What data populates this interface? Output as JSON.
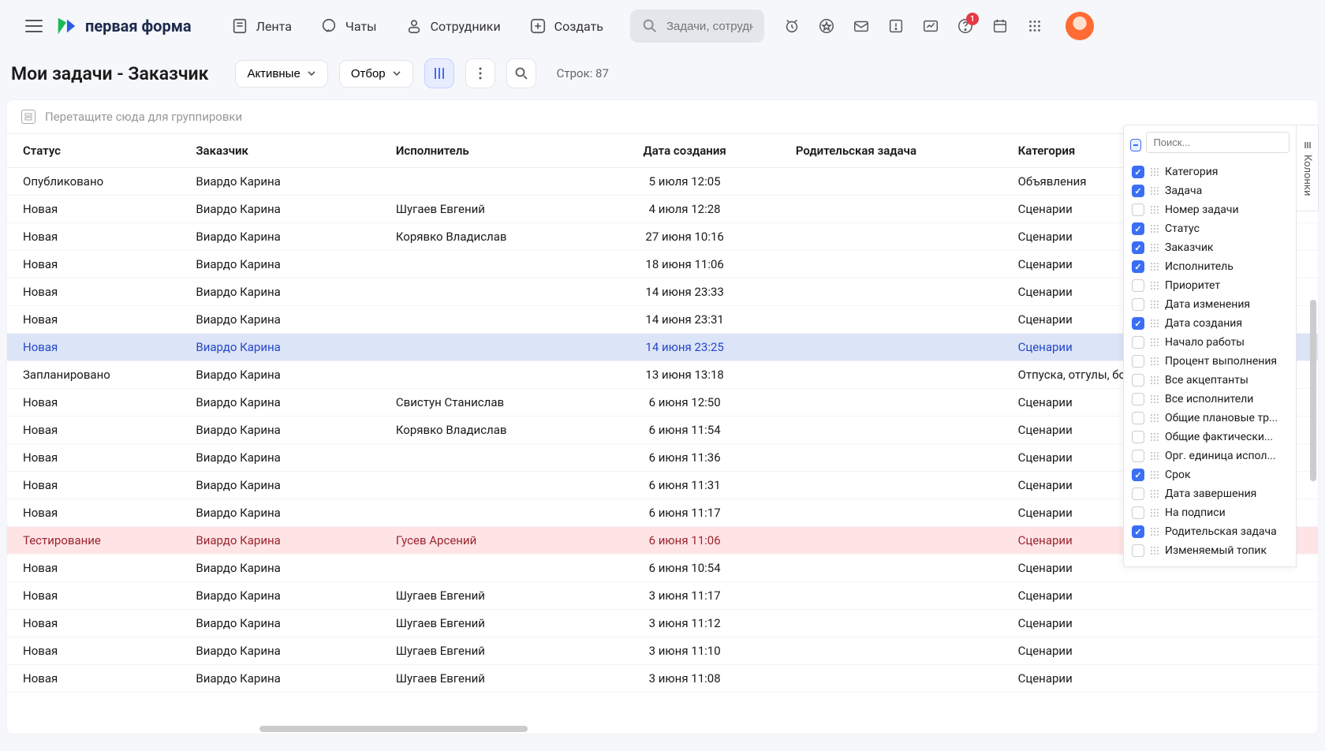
{
  "header": {
    "brand": "первая форма",
    "nav": [
      {
        "icon": "feed",
        "label": "Лента"
      },
      {
        "icon": "chat",
        "label": "Чаты"
      },
      {
        "icon": "users",
        "label": "Сотрудники"
      },
      {
        "icon": "plus",
        "label": "Создать"
      }
    ],
    "search_placeholder": "Задачи, сотрудн",
    "badge_count": "1"
  },
  "toolbar": {
    "title": "Мои задачи - Заказчик",
    "filter_active": "Активные",
    "filter_select": "Отбор",
    "rows_label": "Строк: 87"
  },
  "group_hint": "Перетащите сюда для группировки",
  "columns": [
    "Статус",
    "Заказчик",
    "Исполнитель",
    "Дата создания",
    "Родительская задача",
    "Категория"
  ],
  "rows": [
    {
      "status": "Опубликовано",
      "customer": "Виардо Карина",
      "executor": "",
      "date": "5 июля 12:05",
      "parent": "",
      "category": "Объявления",
      "state": ""
    },
    {
      "status": "Новая",
      "customer": "Виардо Карина",
      "executor": "Шугаев Евгений",
      "date": "4 июля 12:28",
      "parent": "",
      "category": "Сценарии",
      "state": ""
    },
    {
      "status": "Новая",
      "customer": "Виардо Карина",
      "executor": "Корявко Владислав",
      "date": "27 июня 10:16",
      "parent": "",
      "category": "Сценарии",
      "state": ""
    },
    {
      "status": "Новая",
      "customer": "Виардо Карина",
      "executor": "",
      "date": "18 июня 11:06",
      "parent": "",
      "category": "Сценарии",
      "state": ""
    },
    {
      "status": "Новая",
      "customer": "Виардо Карина",
      "executor": "",
      "date": "14 июня 23:33",
      "parent": "",
      "category": "Сценарии",
      "state": ""
    },
    {
      "status": "Новая",
      "customer": "Виардо Карина",
      "executor": "",
      "date": "14 июня 23:31",
      "parent": "",
      "category": "Сценарии",
      "state": ""
    },
    {
      "status": "Новая",
      "customer": "Виардо Карина",
      "executor": "",
      "date": "14 июня 23:25",
      "parent": "",
      "category": "Сценарии",
      "state": "selected"
    },
    {
      "status": "Запланировано",
      "customer": "Виардо Карина",
      "executor": "",
      "date": "13 июня 13:18",
      "parent": "",
      "category": "Отпуска, отгулы, больничные",
      "state": ""
    },
    {
      "status": "Новая",
      "customer": "Виардо Карина",
      "executor": "Свистун Станислав",
      "date": "6 июня 12:50",
      "parent": "",
      "category": "Сценарии",
      "state": ""
    },
    {
      "status": "Новая",
      "customer": "Виардо Карина",
      "executor": "Корявко Владислав",
      "date": "6 июня 11:54",
      "parent": "",
      "category": "Сценарии",
      "state": ""
    },
    {
      "status": "Новая",
      "customer": "Виардо Карина",
      "executor": "",
      "date": "6 июня 11:36",
      "parent": "",
      "category": "Сценарии",
      "state": ""
    },
    {
      "status": "Новая",
      "customer": "Виардо Карина",
      "executor": "",
      "date": "6 июня 11:31",
      "parent": "",
      "category": "Сценарии",
      "state": ""
    },
    {
      "status": "Новая",
      "customer": "Виардо Карина",
      "executor": "",
      "date": "6 июня 11:17",
      "parent": "",
      "category": "Сценарии",
      "state": ""
    },
    {
      "status": "Тестирование",
      "customer": "Виардо Карина",
      "executor": "Гусев Арсений",
      "date": "6 июня 11:06",
      "parent": "",
      "category": "Сценарии",
      "state": "highlighted"
    },
    {
      "status": "Новая",
      "customer": "Виардо Карина",
      "executor": "",
      "date": "6 июня 10:54",
      "parent": "",
      "category": "Сценарии",
      "state": ""
    },
    {
      "status": "Новая",
      "customer": "Виардо Карина",
      "executor": "Шугаев Евгений",
      "date": "3 июня 11:17",
      "parent": "",
      "category": "Сценарии",
      "state": ""
    },
    {
      "status": "Новая",
      "customer": "Виардо Карина",
      "executor": "Шугаев Евгений",
      "date": "3 июня 11:12",
      "parent": "",
      "category": "Сценарии",
      "state": ""
    },
    {
      "status": "Новая",
      "customer": "Виардо Карина",
      "executor": "Шугаев Евгений",
      "date": "3 июня 11:10",
      "parent": "",
      "category": "Сценарии",
      "state": ""
    },
    {
      "status": "Новая",
      "customer": "Виардо Карина",
      "executor": "Шугаев Евгений",
      "date": "3 июня 11:08",
      "parent": "",
      "category": "Сценарии",
      "state": ""
    }
  ],
  "columns_panel": {
    "tab_label": "Колонки",
    "search_placeholder": "Поиск...",
    "options": [
      {
        "label": "Категория",
        "checked": true
      },
      {
        "label": "Задача",
        "checked": true
      },
      {
        "label": "Номер задачи",
        "checked": false
      },
      {
        "label": "Статус",
        "checked": true
      },
      {
        "label": "Заказчик",
        "checked": true
      },
      {
        "label": "Исполнитель",
        "checked": true
      },
      {
        "label": "Приоритет",
        "checked": false
      },
      {
        "label": "Дата изменения",
        "checked": false
      },
      {
        "label": "Дата создания",
        "checked": true
      },
      {
        "label": "Начало работы",
        "checked": false
      },
      {
        "label": "Процент выполнения",
        "checked": false
      },
      {
        "label": "Все акцептанты",
        "checked": false
      },
      {
        "label": "Все исполнители",
        "checked": false
      },
      {
        "label": "Общие плановые тр...",
        "checked": false
      },
      {
        "label": "Общие фактически...",
        "checked": false
      },
      {
        "label": "Орг. единица испол...",
        "checked": false
      },
      {
        "label": "Срок",
        "checked": true
      },
      {
        "label": "Дата завершения",
        "checked": false
      },
      {
        "label": "На подписи",
        "checked": false
      },
      {
        "label": "Родительская задача",
        "checked": true
      },
      {
        "label": "Изменяемый топик",
        "checked": false
      }
    ]
  }
}
